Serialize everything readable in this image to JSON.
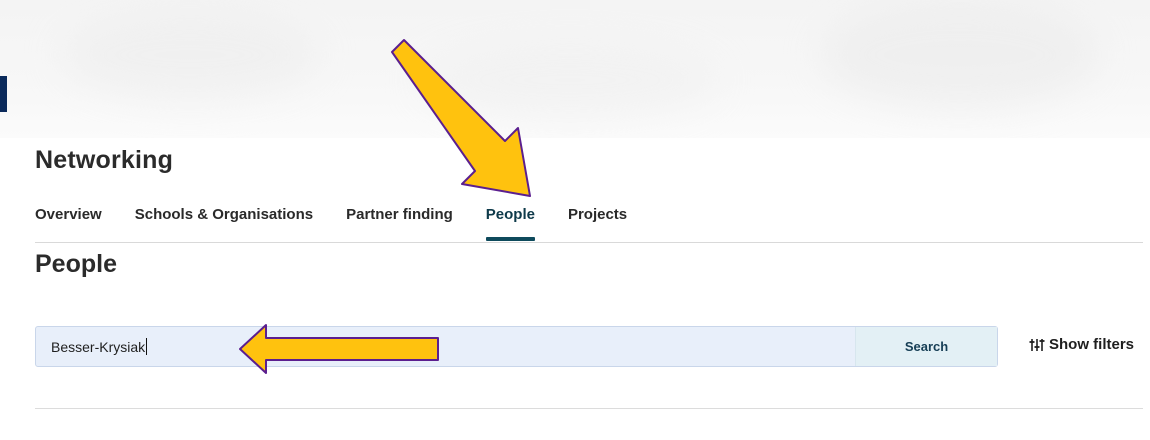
{
  "header": {
    "section_title": "Networking"
  },
  "tabs": [
    {
      "label": "Overview",
      "active": false
    },
    {
      "label": "Schools & Organisations",
      "active": false
    },
    {
      "label": "Partner finding",
      "active": false
    },
    {
      "label": "People",
      "active": true
    },
    {
      "label": "Projects",
      "active": false
    }
  ],
  "main": {
    "page_title": "People",
    "search": {
      "value": "Besser-Krysiak",
      "button_label": "Search"
    },
    "filters_label": "Show filters"
  },
  "annotations": {
    "arrow_color": "#FFC20E",
    "arrow_outline": "#5B1F8F"
  },
  "colors": {
    "accent": "#0E4A5C",
    "search_bg": "#E8EFFA",
    "hero_bar": "#0B2A5B"
  }
}
